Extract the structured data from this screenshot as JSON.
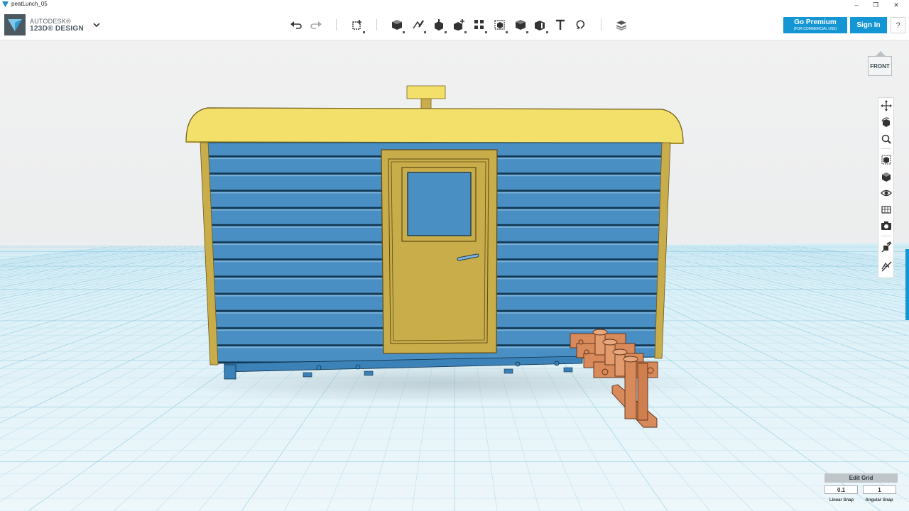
{
  "window": {
    "title": "peatLunch_05",
    "controls": {
      "minimize": "–",
      "restore": "❐",
      "close": "✕"
    }
  },
  "brand": {
    "line1": "AUTODESK®",
    "line2": "123D® DESIGN"
  },
  "toolbar": {
    "icons": [
      "undo-icon",
      "redo-icon",
      "transform-icon",
      "primitives-icon",
      "sketch-icon",
      "construct-icon",
      "modify-icon",
      "pattern-icon",
      "grouping-icon",
      "combine-icon",
      "measure-icon",
      "text-icon",
      "snap-icon",
      "material-icon"
    ]
  },
  "account": {
    "premium_label": "Go Premium",
    "premium_sub": "(FOR COMMERCIAL USE)",
    "signin_label": "Sign In",
    "help_label": "?"
  },
  "viewcube": {
    "face_label": "FRONT"
  },
  "navbar": {
    "icons": [
      "pan-icon",
      "orbit-icon",
      "zoom-icon",
      "fit-icon",
      "view-solid-icon",
      "visibility-icon",
      "materials-visibility-icon",
      "camera-icon",
      "hide-sketch-icon",
      "hide-mesh-icon"
    ]
  },
  "grid": {
    "title": "Edit Grid",
    "linear_snap": {
      "value": "0.1",
      "label": "Linear Snap"
    },
    "angular_snap": {
      "value": "1",
      "label": "Angular Snap"
    }
  },
  "colors": {
    "accent": "#1496d4",
    "roof": "#f2e06a",
    "trim": "#c9ad4a",
    "walls": "#4a8fc4",
    "pipes": "#d88a5a"
  }
}
